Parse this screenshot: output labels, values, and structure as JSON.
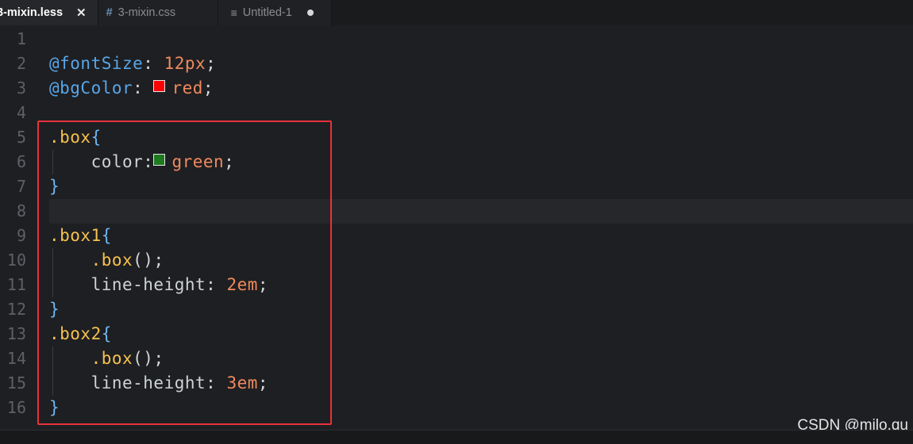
{
  "tabs": [
    {
      "name": "tab-mixin-less",
      "label": "3-mixin.less",
      "active": true
    },
    {
      "name": "tab-mixin-css",
      "label": "3-mixin.css",
      "active": false
    },
    {
      "name": "tab-untitled",
      "label": "Untitled-1",
      "active": false
    }
  ],
  "editor": {
    "lines": [
      {
        "n": "1"
      },
      {
        "n": "2"
      },
      {
        "n": "3"
      },
      {
        "n": "4"
      },
      {
        "n": "5"
      },
      {
        "n": "6"
      },
      {
        "n": "7"
      },
      {
        "n": "8"
      },
      {
        "n": "9"
      },
      {
        "n": "10"
      },
      {
        "n": "11"
      },
      {
        "n": "12"
      },
      {
        "n": "13"
      },
      {
        "n": "14"
      },
      {
        "n": "15"
      },
      {
        "n": "16"
      }
    ],
    "code": {
      "l2_var": "@fontSize",
      "l2_colon": ": ",
      "l2_val": "12px",
      "l2_semi": ";",
      "l3_var": "@bgColor",
      "l3_colon": ": ",
      "l3_val": "red",
      "l3_semi": ";",
      "l5_sel": ".box",
      "l5_brace": "{",
      "l6_prop": "    color:",
      "l6_val": "green",
      "l6_semi": ";",
      "l7_brace": "}",
      "l9_sel": ".box1",
      "l9_brace": "{",
      "l10_call": "    .box",
      "l10_paren": "();",
      "l11_prop": "    line-height: ",
      "l11_val": "2em",
      "l11_semi": ";",
      "l12_brace": "}",
      "l13_sel": ".box2",
      "l13_brace": "{",
      "l14_call": "    .box",
      "l14_paren": "();",
      "l15_prop": "    line-height: ",
      "l15_val": "3em",
      "l15_semi": ";",
      "l16_brace": "}"
    },
    "swatch_red": "#ff0000",
    "swatch_green": "#1f7a1f"
  },
  "watermark": "CSDN @milo.qu"
}
